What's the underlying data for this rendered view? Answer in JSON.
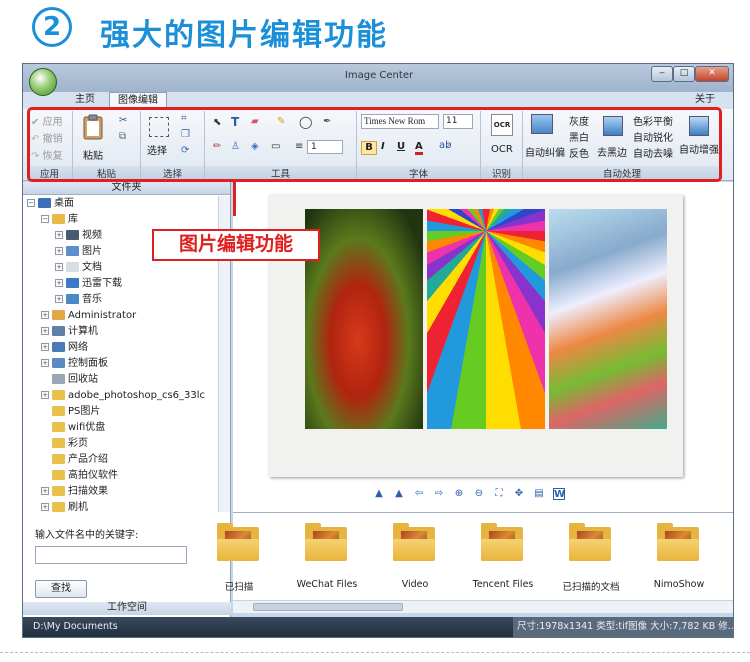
{
  "header": {
    "num": "2",
    "title": "强大的图片编辑功能"
  },
  "window": {
    "title": "Image Center",
    "controls": {
      "minimize": "‒",
      "maximize": "□",
      "close": "✕"
    }
  },
  "tabs": [
    {
      "label": "主页"
    },
    {
      "label": "图像编辑"
    }
  ],
  "about": "关于",
  "ribbon": {
    "apply": {
      "label": "应用",
      "items": [
        "应用",
        "撤销",
        "恢复"
      ]
    },
    "paste": {
      "label": "粘贴",
      "main": "粘贴"
    },
    "select": {
      "label": "选择",
      "main": "选择"
    },
    "tools": {
      "label": "工具",
      "line_width": "1"
    },
    "font": {
      "label": "字体",
      "family": "Times New Rom",
      "size": "11",
      "bold": "B",
      "italic": "I",
      "underline": "U",
      "color_a": "A"
    },
    "ocr": {
      "label": "识别",
      "main": "OCR"
    },
    "auto": {
      "label": "自动处理",
      "deskew": "自动纠偏",
      "grayscale": "灰度",
      "bw": "黑白",
      "invert": "反色",
      "remove_black_edge": "去黑边",
      "color_balance": "色彩平衡",
      "auto_sharpen": "自动锐化",
      "auto_denoise": "自动去噪",
      "auto_enhance": "自动增强"
    }
  },
  "callout": "图片编辑功能",
  "folder_panel": {
    "title": "文件夹",
    "tree": [
      {
        "label": "桌面",
        "level": 0,
        "pm": "⊟",
        "color": "#3b6fb8"
      },
      {
        "label": "库",
        "level": 1,
        "pm": "⊟",
        "color": "#e8b84a"
      },
      {
        "label": "视频",
        "level": 2,
        "pm": "⊞",
        "color": "#4a5a70"
      },
      {
        "label": "图片",
        "level": 2,
        "pm": "⊞",
        "color": "#5b8fd0"
      },
      {
        "label": "文档",
        "level": 2,
        "pm": "⊞",
        "color": "#d8dde6"
      },
      {
        "label": "迅雷下载",
        "level": 2,
        "pm": "⊞",
        "color": "#3a7ac8"
      },
      {
        "label": "音乐",
        "level": 2,
        "pm": "⊞",
        "color": "#4b88c8"
      },
      {
        "label": "Administrator",
        "level": 1,
        "pm": "⊞",
        "color": "#e0a848"
      },
      {
        "label": "计算机",
        "level": 1,
        "pm": "⊞",
        "color": "#5f7fa8"
      },
      {
        "label": "网络",
        "level": 1,
        "pm": "⊞",
        "color": "#4a7ab8"
      },
      {
        "label": "控制面板",
        "level": 1,
        "pm": "⊞",
        "color": "#5b8ac0"
      },
      {
        "label": "回收站",
        "level": 1,
        "pm": "",
        "color": "#9aa6b5"
      },
      {
        "label": "adobe_photoshop_cs6_33lc",
        "level": 1,
        "pm": "⊞",
        "color": "#e8c04a"
      },
      {
        "label": "PS图片",
        "level": 1,
        "pm": "",
        "color": "#e8c04a"
      },
      {
        "label": "wifi优盘",
        "level": 1,
        "pm": "",
        "color": "#e8c04a"
      },
      {
        "label": "彩页",
        "level": 1,
        "pm": "",
        "color": "#e8c04a"
      },
      {
        "label": "产品介绍",
        "level": 1,
        "pm": "",
        "color": "#e8c04a"
      },
      {
        "label": "高拍仪软件",
        "level": 1,
        "pm": "",
        "color": "#e8c04a"
      },
      {
        "label": "扫描效果",
        "level": 1,
        "pm": "⊞",
        "color": "#e8c04a"
      },
      {
        "label": "刷机",
        "level": 1,
        "pm": "⊞",
        "color": "#e8c04a"
      }
    ],
    "keyword_label": "输入文件名中的关键字:",
    "search_button": "查找",
    "workspace": "工作空间"
  },
  "thumbnails": [
    {
      "label": "已扫描"
    },
    {
      "label": "WeChat Files"
    },
    {
      "label": "Video"
    },
    {
      "label": "Tencent Files"
    },
    {
      "label": "已扫描的文档"
    },
    {
      "label": "NimoShow"
    }
  ],
  "status": {
    "path": "D:\\My Documents",
    "info": "尺寸:1978x1341 类型:tif图像 大小:7,782 KB 修..."
  },
  "colors": {
    "accent": "#1b8fd8",
    "highlight": "#e02020"
  }
}
